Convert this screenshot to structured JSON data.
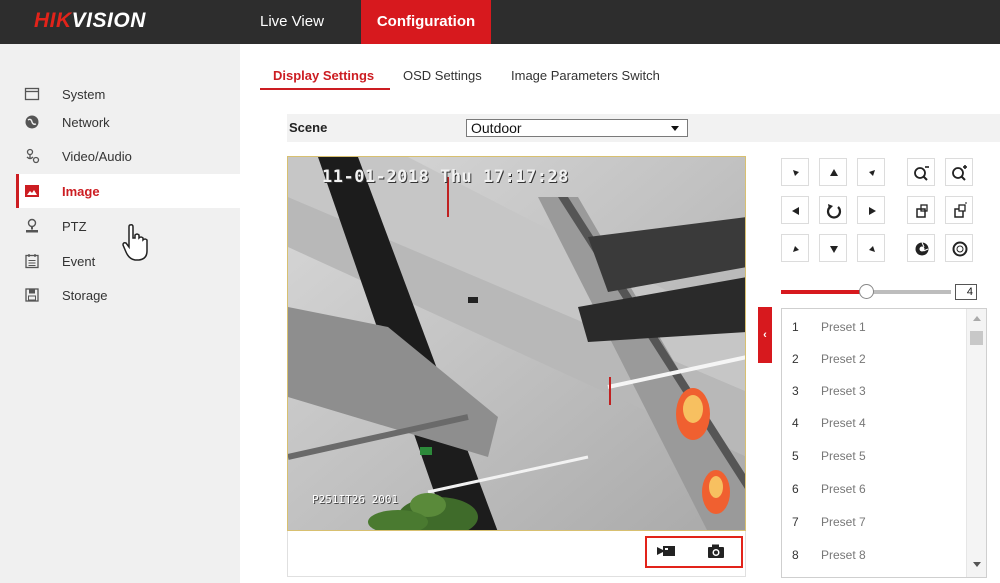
{
  "header": {
    "logo_left": "HIK",
    "logo_right": "VISION",
    "nav": [
      {
        "label": "Live View"
      },
      {
        "label": "Configuration"
      }
    ]
  },
  "sidebar": {
    "items": [
      {
        "label": "System",
        "icon": "monitor-icon"
      },
      {
        "label": "Network",
        "icon": "globe-icon"
      },
      {
        "label": "Video/Audio",
        "icon": "video-audio-icon"
      },
      {
        "label": "Image",
        "icon": "image-icon"
      },
      {
        "label": "PTZ",
        "icon": "ptz-camera-icon"
      },
      {
        "label": "Event",
        "icon": "calendar-icon"
      },
      {
        "label": "Storage",
        "icon": "floppy-disk-icon"
      }
    ],
    "active": "Image"
  },
  "tabs": [
    {
      "label": "Display Settings"
    },
    {
      "label": "OSD Settings"
    },
    {
      "label": "Image Parameters Switch"
    }
  ],
  "scene": {
    "label": "Scene",
    "value": "Outdoor"
  },
  "video": {
    "timestamp": "11-01-2018 Thu 17:17:28",
    "caption": "P251IT26  2001"
  },
  "ptz": {
    "speed_value": "4",
    "speed_fraction": 0.5
  },
  "presets": [
    {
      "num": "1",
      "name": "Preset 1"
    },
    {
      "num": "2",
      "name": "Preset 2"
    },
    {
      "num": "3",
      "name": "Preset 3"
    },
    {
      "num": "4",
      "name": "Preset 4"
    },
    {
      "num": "5",
      "name": "Preset 5"
    },
    {
      "num": "6",
      "name": "Preset 6"
    },
    {
      "num": "7",
      "name": "Preset 7"
    },
    {
      "num": "8",
      "name": "Preset 8"
    }
  ],
  "colors": {
    "accent": "#d7191e",
    "topbar": "#2d2d2d",
    "sidebar": "#f0f0f0"
  }
}
